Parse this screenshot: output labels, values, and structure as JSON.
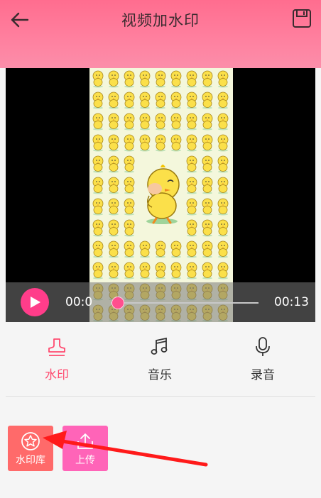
{
  "header": {
    "title": "视频加水印",
    "back_icon": "back-arrow-icon",
    "save_icon": "save-icon"
  },
  "player": {
    "current_time": "00:0",
    "total_time": "00:13",
    "progress": 0.05,
    "play_icon": "play-icon"
  },
  "tabs": [
    {
      "label": "水印",
      "icon": "stamp-icon",
      "active": true
    },
    {
      "label": "音乐",
      "icon": "music-note-icon",
      "active": false
    },
    {
      "label": "录音",
      "icon": "microphone-icon",
      "active": false
    }
  ],
  "tools": {
    "watermark_library": {
      "label": "水印库",
      "icon": "star-badge-icon"
    },
    "upload": {
      "label": "上传",
      "icon": "upload-icon"
    }
  },
  "colors": {
    "accent": "#ff4a6f",
    "play": "#ff3d8a",
    "tool_library": "#ff6a6a",
    "tool_upload": "#ff64b8",
    "annotation_arrow": "#ff1a1a"
  }
}
